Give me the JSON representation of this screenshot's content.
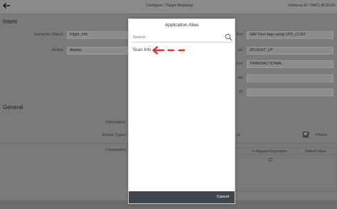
{
  "header": {
    "back_icon": "arrow-left-icon",
    "title": "Configure: 'Target Mapping'",
    "instance": "Instance ID: 5WCL4CW.8G"
  },
  "intent": {
    "section_title": "Intent",
    "semantic_object_label": "Semantic Object:",
    "semantic_object_value": "Flight_Info",
    "action_label": "Action:",
    "action_value": "display"
  },
  "target": {
    "app_label_tail": "tion:",
    "app_value": "SAP Fiori App using LPD_CUST",
    "role_label_tail": "ole:",
    "role_value": "ZFLIGHT_LP",
    "instance_label_tail": "nce:",
    "instance_value": "TRANSACTIONAL",
    "alias_label_tail": "ias:",
    "id_label_tail": "ID:"
  },
  "general": {
    "section_title": "General",
    "information_label": "Information:",
    "device_types_label": "Device Types:",
    "device_types_tail": "pt",
    "phone_label": "Phone",
    "phone_checked": true,
    "parameters_label": "Parameters:",
    "param_cols": [
      "Is Regular Expression",
      "Default Value"
    ]
  },
  "dialog": {
    "title": "Application Alias",
    "search_placeholder": "Search",
    "items": [
      "Scan Info"
    ],
    "cancel_label": "Cancel",
    "annotation_color": "#e0302e"
  }
}
